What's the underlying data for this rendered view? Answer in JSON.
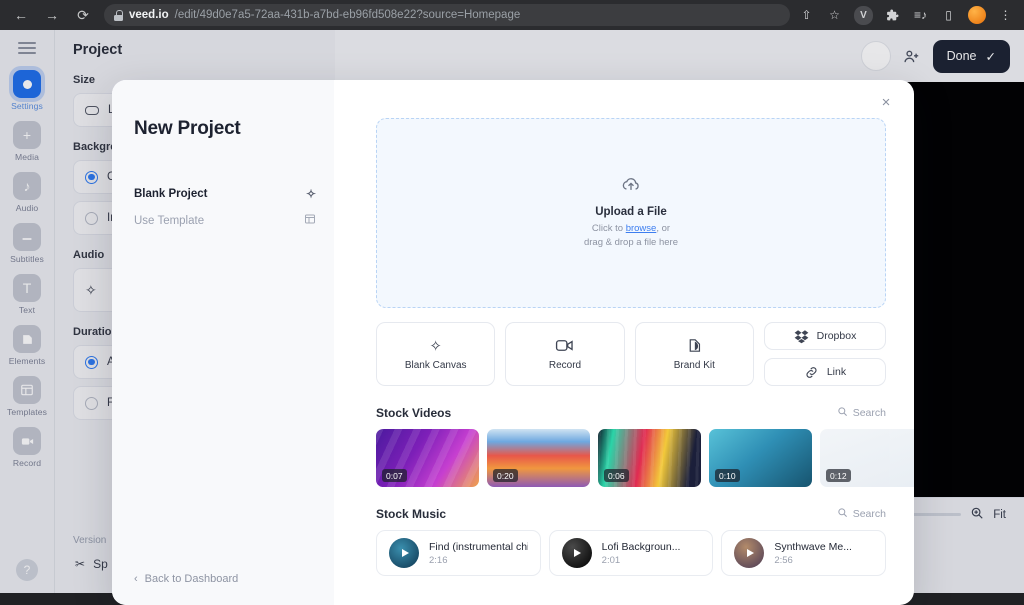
{
  "browser": {
    "back_icon": "←",
    "forward_icon": "→",
    "reload_icon": "⟳",
    "url_domain": "veed.io",
    "url_path": "/edit/49d0e7a5-72aa-431b-a7bd-eb96fd508e22?source=Homepage",
    "share_icon": "⇧",
    "bookmark_icon": "☆",
    "extension_v": "V",
    "puzzle_icon": "🧩",
    "list_icon": "≡♪",
    "split_icon": "▯",
    "menu_icon": "⋮"
  },
  "rail": {
    "items": [
      {
        "label": "Settings",
        "icon": "settings-icon"
      },
      {
        "label": "Media",
        "icon": "plus-icon"
      },
      {
        "label": "Audio",
        "icon": "music-note-icon"
      },
      {
        "label": "Subtitles",
        "icon": "subtitles-icon"
      },
      {
        "label": "Text",
        "icon": "text-icon"
      },
      {
        "label": "Elements",
        "icon": "elements-icon"
      },
      {
        "label": "Templates",
        "icon": "templates-icon"
      },
      {
        "label": "Record",
        "icon": "camera-icon"
      }
    ],
    "help_icon": "?"
  },
  "panel": {
    "title": "Project",
    "size_label": "Size",
    "size_value": "L",
    "background_label": "Background",
    "background_color_option": "Co",
    "background_image_option": "Im",
    "audio_label": "Audio",
    "duration_label": "Duration",
    "duration_auto_option": "Au",
    "duration_fixed_option": "Fi",
    "version_label": "Version",
    "split_label": "Sp"
  },
  "topbar": {
    "invite_icon": "invite-icon",
    "done_label": "Done",
    "done_check": "✓"
  },
  "timeline": {
    "zoom_in_icon": "zoom-in-icon",
    "fit_label": "Fit"
  },
  "modal": {
    "title": "New Project",
    "close_icon": "×",
    "nav": [
      {
        "label": "Blank Project",
        "icon": "sparkle-icon",
        "selected": true
      },
      {
        "label": "Use Template",
        "icon": "layout-icon",
        "selected": false
      }
    ],
    "back_label": "Back to Dashboard",
    "back_chevron": "‹",
    "upload": {
      "icon": "cloud-upload-icon",
      "title": "Upload a File",
      "sub_prefix": "Click to ",
      "sub_link": "browse",
      "sub_suffix": ", or",
      "sub_line2": "drag & drop a file here"
    },
    "tiles": [
      {
        "label": "Blank Canvas",
        "icon": "sparkle-icon"
      },
      {
        "label": "Record",
        "icon": "camera-icon"
      },
      {
        "label": "Brand Kit",
        "icon": "brand-kit-icon"
      }
    ],
    "side_tiles": [
      {
        "label": "Dropbox",
        "icon": "dropbox-icon"
      },
      {
        "label": "Link",
        "icon": "link-icon"
      }
    ],
    "stock_videos": {
      "heading": "Stock Videos",
      "search_label": "Search",
      "search_icon": "search-icon",
      "items": [
        {
          "duration": "0:07"
        },
        {
          "duration": "0:20"
        },
        {
          "duration": "0:06"
        },
        {
          "duration": "0:10"
        },
        {
          "duration": "0:12"
        }
      ]
    },
    "stock_music": {
      "heading": "Stock Music",
      "search_label": "Search",
      "search_icon": "search-icon",
      "items": [
        {
          "name": "Find (instrumental chill lo",
          "duration": "2:16"
        },
        {
          "name": "Lofi Backgroun...",
          "duration": "2:01"
        },
        {
          "name": "Synthwave Me...",
          "duration": "2:56"
        }
      ]
    }
  },
  "colors": {
    "accent": "#2f7df6",
    "link": "#3d7ef0",
    "done_bg": "#1c2333",
    "dropzone_bg": "#f3f8fe"
  }
}
